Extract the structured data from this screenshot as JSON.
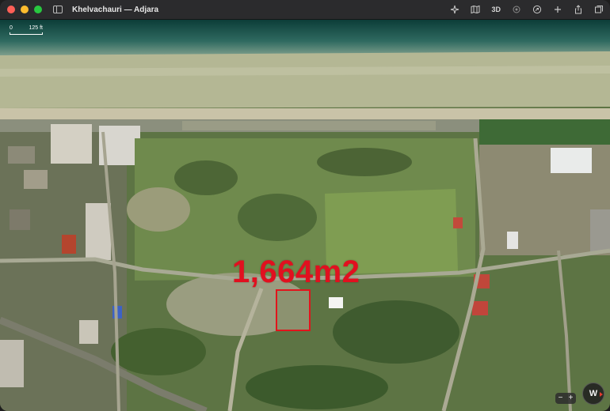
{
  "window": {
    "title": "Khelvachauri — Adjara"
  },
  "toolbar": {
    "three_d_label": "3D",
    "icons": [
      "location-arrow-icon",
      "map-mode-icon",
      "3d-toggle",
      "look-around-icon",
      "directions-icon",
      "add-icon",
      "share-icon",
      "window-tabs-icon"
    ]
  },
  "scale": {
    "start": "0",
    "end": "125 ft"
  },
  "annotation": {
    "area": "1,664m2",
    "color": "#e2141c"
  },
  "controls": {
    "zoom_out": "−",
    "zoom_in": "+",
    "compass": "W"
  }
}
